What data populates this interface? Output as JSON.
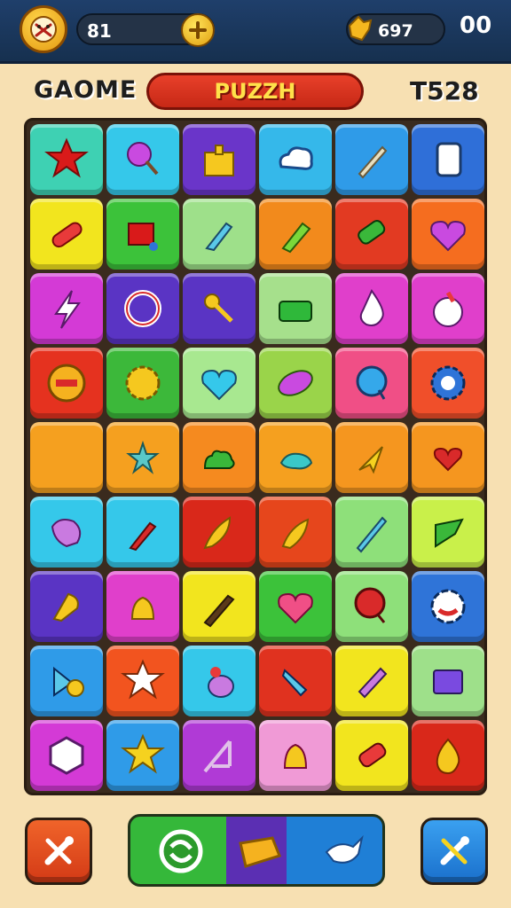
{
  "header": {
    "lives_value": "81",
    "coins_value": "697",
    "top_right_value": "00"
  },
  "title_bar": {
    "left_label": "GAOME",
    "banner_label": "PUZZH",
    "right_label": "T528"
  },
  "colors": {
    "topbar": "#1f3f6b",
    "panel": "#f7e0b2",
    "banner": "#e8402a",
    "board_border": "#3a2b1e"
  },
  "board": {
    "rows": [
      [
        {
          "bg": "#3ed1b3",
          "icon": "red-star-icon"
        },
        {
          "bg": "#35c8ea",
          "icon": "lollipop-icon"
        },
        {
          "bg": "#6a35c9",
          "icon": "gift-box-icon"
        },
        {
          "bg": "#35b8ea",
          "icon": "cloud-icon"
        },
        {
          "bg": "#2f9be8",
          "icon": "crystal-sword-icon"
        },
        {
          "bg": "#2f6fd8",
          "icon": "white-card-icon"
        }
      ],
      [
        {
          "bg": "#f2e51e",
          "icon": "bandage-icon"
        },
        {
          "bg": "#3cc23a",
          "icon": "red-block-icon"
        },
        {
          "bg": "#9ee08a",
          "icon": "paintbrush-icon"
        },
        {
          "bg": "#f28a1c",
          "icon": "green-marker-icon"
        },
        {
          "bg": "#e23a22",
          "icon": "phone-icon"
        },
        {
          "bg": "#f56d1f",
          "icon": "purple-heart-icon"
        }
      ],
      [
        {
          "bg": "#d43ad6",
          "icon": "lightning-icon"
        },
        {
          "bg": "#5a34c4",
          "icon": "ring-icon"
        },
        {
          "bg": "#5a34c4",
          "icon": "wand-icon"
        },
        {
          "bg": "#a6e08c",
          "icon": "basket-icon"
        },
        {
          "bg": "#e03fcb",
          "icon": "drop-icon"
        },
        {
          "bg": "#e03fcb",
          "icon": "cream-icon"
        }
      ],
      [
        {
          "bg": "#e5321f",
          "icon": "cookie-icon"
        },
        {
          "bg": "#3cb83a",
          "icon": "sun-gear-icon"
        },
        {
          "bg": "#a8e890",
          "icon": "blue-heart-icon"
        },
        {
          "bg": "#9ad44a",
          "icon": "leaf-ball-icon"
        },
        {
          "bg": "#f04f86",
          "icon": "balloon-icon"
        },
        {
          "bg": "#f04f2a",
          "icon": "blue-gear-icon"
        }
      ],
      [
        {
          "bg": "#f5a01f",
          "icon": "empty-icon"
        },
        {
          "bg": "#f5a01f",
          "icon": "teal-star-icon"
        },
        {
          "bg": "#f58a1f",
          "icon": "green-blob-icon"
        },
        {
          "bg": "#f5a01f",
          "icon": "teal-fish-icon"
        },
        {
          "bg": "#f5961f",
          "icon": "yellow-arrow-icon"
        },
        {
          "bg": "#f5961f",
          "icon": "red-heart-icon"
        }
      ],
      [
        {
          "bg": "#35c8ea",
          "icon": "popsicle-icon"
        },
        {
          "bg": "#35c8ea",
          "icon": "red-brush-icon"
        },
        {
          "bg": "#d9281a",
          "icon": "gold-feather-icon"
        },
        {
          "bg": "#e6461c",
          "icon": "bell-flower-icon"
        },
        {
          "bg": "#8ee07a",
          "icon": "blue-sword-icon"
        },
        {
          "bg": "#c9f04a",
          "icon": "green-pennant-icon"
        }
      ],
      [
        {
          "bg": "#5a34c4",
          "icon": "rocket-icon"
        },
        {
          "bg": "#e03fcb",
          "icon": "bell-icon"
        },
        {
          "bg": "#f2e51e",
          "icon": "paint-brush-icon"
        },
        {
          "bg": "#3cc23a",
          "icon": "pink-heart-icon"
        },
        {
          "bg": "#8ee07a",
          "icon": "red-balloon-icon"
        },
        {
          "bg": "#2f74d8",
          "icon": "red-flower-icon"
        }
      ],
      [
        {
          "bg": "#2f9be8",
          "icon": "flag-ball-icon"
        },
        {
          "bg": "#f2541f",
          "icon": "white-star-icon"
        },
        {
          "bg": "#35c8ea",
          "icon": "potion-icon"
        },
        {
          "bg": "#e0321f",
          "icon": "blue-tube-icon"
        },
        {
          "bg": "#f2e51e",
          "icon": "pink-tube-icon"
        },
        {
          "bg": "#9ee08a",
          "icon": "chip-icon"
        }
      ],
      [
        {
          "bg": "#d43ad6",
          "icon": "cube-icon"
        },
        {
          "bg": "#2f9be8",
          "icon": "yellow-star-icon"
        },
        {
          "bg": "#b03ad6",
          "icon": "harp-icon"
        },
        {
          "bg": "#f09ad6",
          "icon": "yellow-bell-icon"
        },
        {
          "bg": "#f2e51e",
          "icon": "pink-phone-icon"
        },
        {
          "bg": "#d9281a",
          "icon": "fire-icon"
        }
      ]
    ]
  },
  "controls": {
    "left_button_icon": "crossed-tools-icon",
    "right_button_icon": "crossed-tools-icon",
    "boosters": [
      "refresh-icon",
      "gold-ticket-icon",
      "bird-icon"
    ]
  }
}
